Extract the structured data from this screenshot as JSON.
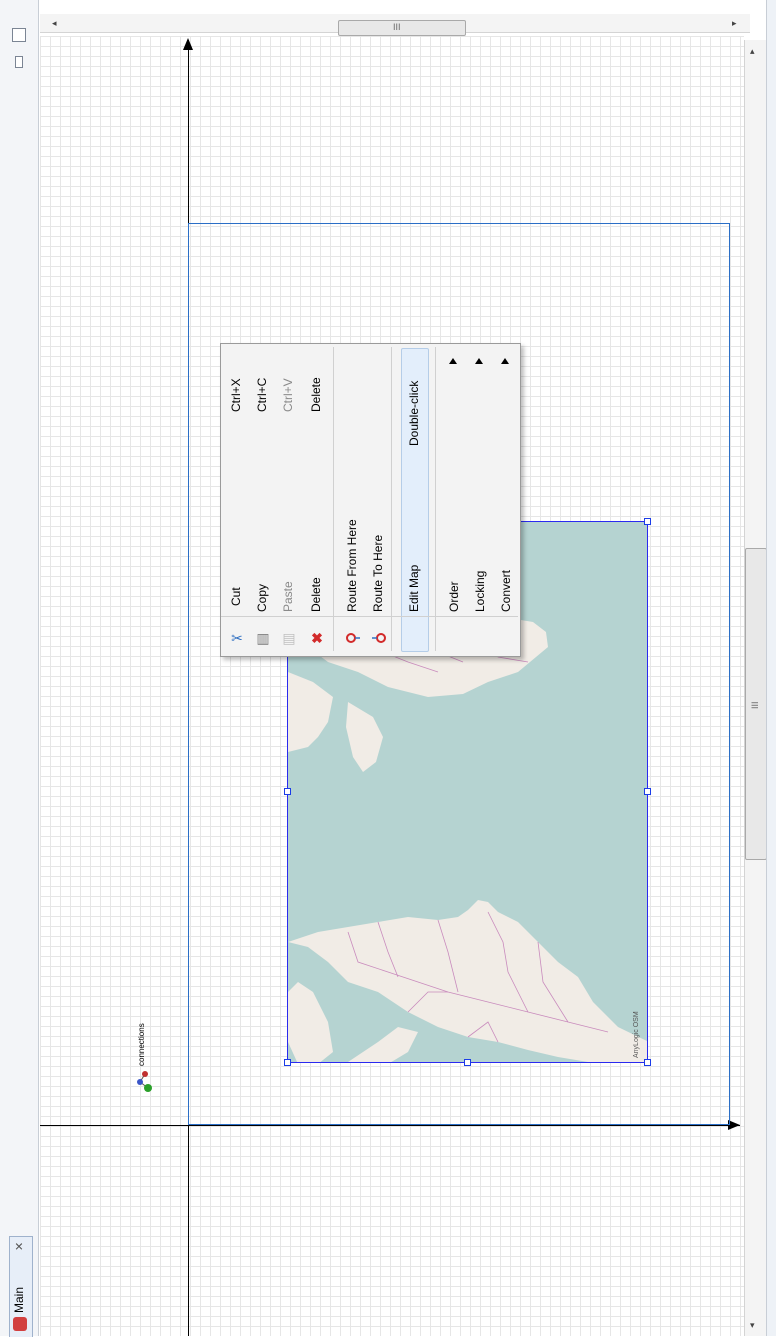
{
  "editor": {
    "tab_label": "Main",
    "close_glyph": "✕",
    "scroll_grip": "III"
  },
  "canvas": {
    "element_label": "connections",
    "map_attribution": "AnyLogic OSM"
  },
  "context_menu": {
    "items": [
      {
        "label": "Cut",
        "shortcut": "Ctrl+X",
        "icon": "scissors-icon",
        "enabled": true
      },
      {
        "label": "Copy",
        "shortcut": "Ctrl+C",
        "icon": "copy-icon",
        "enabled": true
      },
      {
        "label": "Paste",
        "shortcut": "Ctrl+V",
        "icon": "paste-icon",
        "enabled": false
      },
      {
        "label": "Delete",
        "shortcut": "Delete",
        "icon": "delete-icon",
        "enabled": true
      },
      {
        "label": "Route From Here",
        "shortcut": "",
        "icon": "route-from-icon",
        "enabled": true
      },
      {
        "label": "Route To Here",
        "shortcut": "",
        "icon": "route-to-icon",
        "enabled": true
      },
      {
        "label": "Edit Map",
        "shortcut": "Double-click",
        "icon": "",
        "enabled": true,
        "highlighted": true
      },
      {
        "label": "Order",
        "shortcut": "",
        "submenu": true
      },
      {
        "label": "Locking",
        "shortcut": "",
        "submenu": true
      },
      {
        "label": "Convert",
        "shortcut": "",
        "submenu": true
      }
    ]
  },
  "colors": {
    "selection": "#1b3ce8",
    "frame": "#2b6fc7",
    "water": "#b5d3d1",
    "land": "#f1ece6",
    "borders": "#c98bbd"
  }
}
